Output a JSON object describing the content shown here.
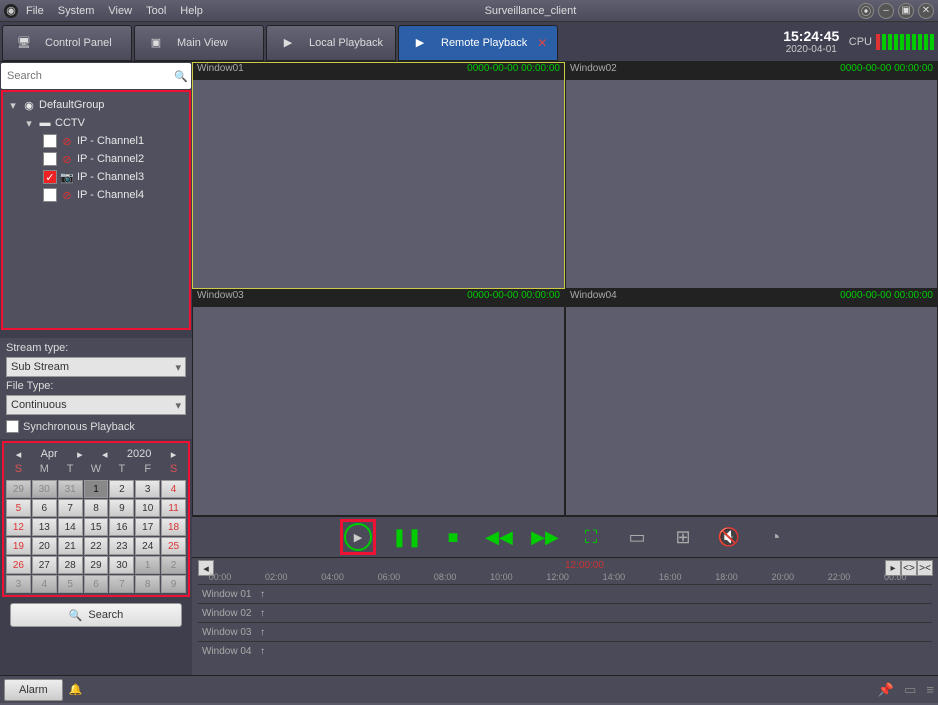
{
  "title": "Surveillance_client",
  "menu": {
    "file": "File",
    "system": "System",
    "view": "View",
    "tool": "Tool",
    "help": "Help"
  },
  "tabs": {
    "controlPanel": "Control Panel",
    "mainView": "Main View",
    "localPlayback": "Local Playback",
    "remotePlayback": "Remote Playback"
  },
  "clock": {
    "time": "15:24:45",
    "date": "2020-04-01"
  },
  "cpu": {
    "label": "CPU"
  },
  "search": {
    "placeholder": "Search"
  },
  "tree": {
    "group": "DefaultGroup",
    "device": "CCTV",
    "channels": [
      {
        "label": "IP - Channel1",
        "checked": false,
        "blocked": true
      },
      {
        "label": "IP - Channel2",
        "checked": false,
        "blocked": true
      },
      {
        "label": "IP - Channel3",
        "checked": true,
        "blocked": false
      },
      {
        "label": "IP - Channel4",
        "checked": false,
        "blocked": true
      }
    ]
  },
  "opts": {
    "streamLabel": "Stream type:",
    "streamValue": "Sub Stream",
    "fileLabel": "File Type:",
    "fileValue": "Continuous",
    "sync": "Synchronous Playback",
    "searchBtn": "Search"
  },
  "calendar": {
    "month": "Apr",
    "year": "2020",
    "dow": [
      "S",
      "M",
      "T",
      "W",
      "T",
      "F",
      "S"
    ],
    "rows": [
      [
        {
          "d": "29",
          "o": true
        },
        {
          "d": "30",
          "o": true
        },
        {
          "d": "31",
          "o": true
        },
        {
          "d": "1",
          "sel": true
        },
        {
          "d": "2"
        },
        {
          "d": "3"
        },
        {
          "d": "4",
          "red": true
        }
      ],
      [
        {
          "d": "5",
          "red": true
        },
        {
          "d": "6"
        },
        {
          "d": "7"
        },
        {
          "d": "8"
        },
        {
          "d": "9"
        },
        {
          "d": "10"
        },
        {
          "d": "11",
          "red": true
        }
      ],
      [
        {
          "d": "12",
          "red": true
        },
        {
          "d": "13"
        },
        {
          "d": "14"
        },
        {
          "d": "15"
        },
        {
          "d": "16"
        },
        {
          "d": "17"
        },
        {
          "d": "18",
          "red": true
        }
      ],
      [
        {
          "d": "19",
          "red": true
        },
        {
          "d": "20"
        },
        {
          "d": "21"
        },
        {
          "d": "22"
        },
        {
          "d": "23"
        },
        {
          "d": "24"
        },
        {
          "d": "25",
          "red": true
        }
      ],
      [
        {
          "d": "26",
          "red": true
        },
        {
          "d": "27"
        },
        {
          "d": "28"
        },
        {
          "d": "29"
        },
        {
          "d": "30"
        },
        {
          "d": "1",
          "o": true
        },
        {
          "d": "2",
          "o": true
        }
      ],
      [
        {
          "d": "3",
          "o": true
        },
        {
          "d": "4",
          "o": true
        },
        {
          "d": "5",
          "o": true
        },
        {
          "d": "6",
          "o": true
        },
        {
          "d": "7",
          "o": true
        },
        {
          "d": "8",
          "o": true
        },
        {
          "d": "9",
          "o": true
        }
      ]
    ]
  },
  "windows": [
    {
      "name": "Window01",
      "ts": "0000-00-00 00:00:00",
      "active": true
    },
    {
      "name": "Window02",
      "ts": "0000-00-00 00:00:00",
      "active": false
    },
    {
      "name": "Window03",
      "ts": "0000-00-00 00:00:00",
      "active": false
    },
    {
      "name": "Window04",
      "ts": "0000-00-00 00:00:00",
      "active": false
    }
  ],
  "timeline": {
    "marker": "12:00:00",
    "ticks": [
      "00:00",
      "02:00",
      "04:00",
      "06:00",
      "08:00",
      "10:00",
      "12:00",
      "14:00",
      "16:00",
      "18:00",
      "20:00",
      "22:00",
      "00:00"
    ],
    "tracks": [
      "Window 01",
      "Window 02",
      "Window 03",
      "Window 04"
    ]
  },
  "footer": {
    "alarm": "Alarm"
  }
}
